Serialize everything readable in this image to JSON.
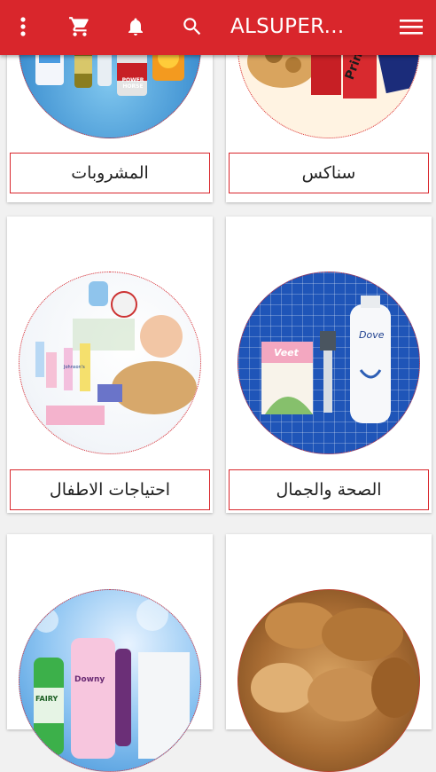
{
  "app": {
    "title": "ALSUPER...",
    "accent": "#d9262c",
    "icons": [
      "more-vert-icon",
      "cart-icon",
      "bell-icon",
      "search-icon",
      "menu-icon"
    ]
  },
  "categories": [
    {
      "label": "سناكس",
      "image_caption": "Pringles"
    },
    {
      "label": "المشروبات",
      "image_caption": "POWER HORSE"
    },
    {
      "label": "الصحة والجمال",
      "image_caption": "Veet",
      "image_caption_2": "Dove"
    },
    {
      "label": "احتياجات الاطفال",
      "image_caption": "Johnson's"
    },
    {
      "label": "",
      "image_caption": ""
    },
    {
      "label": "",
      "image_caption": "FAIRY",
      "image_caption_2": "Downy"
    }
  ]
}
